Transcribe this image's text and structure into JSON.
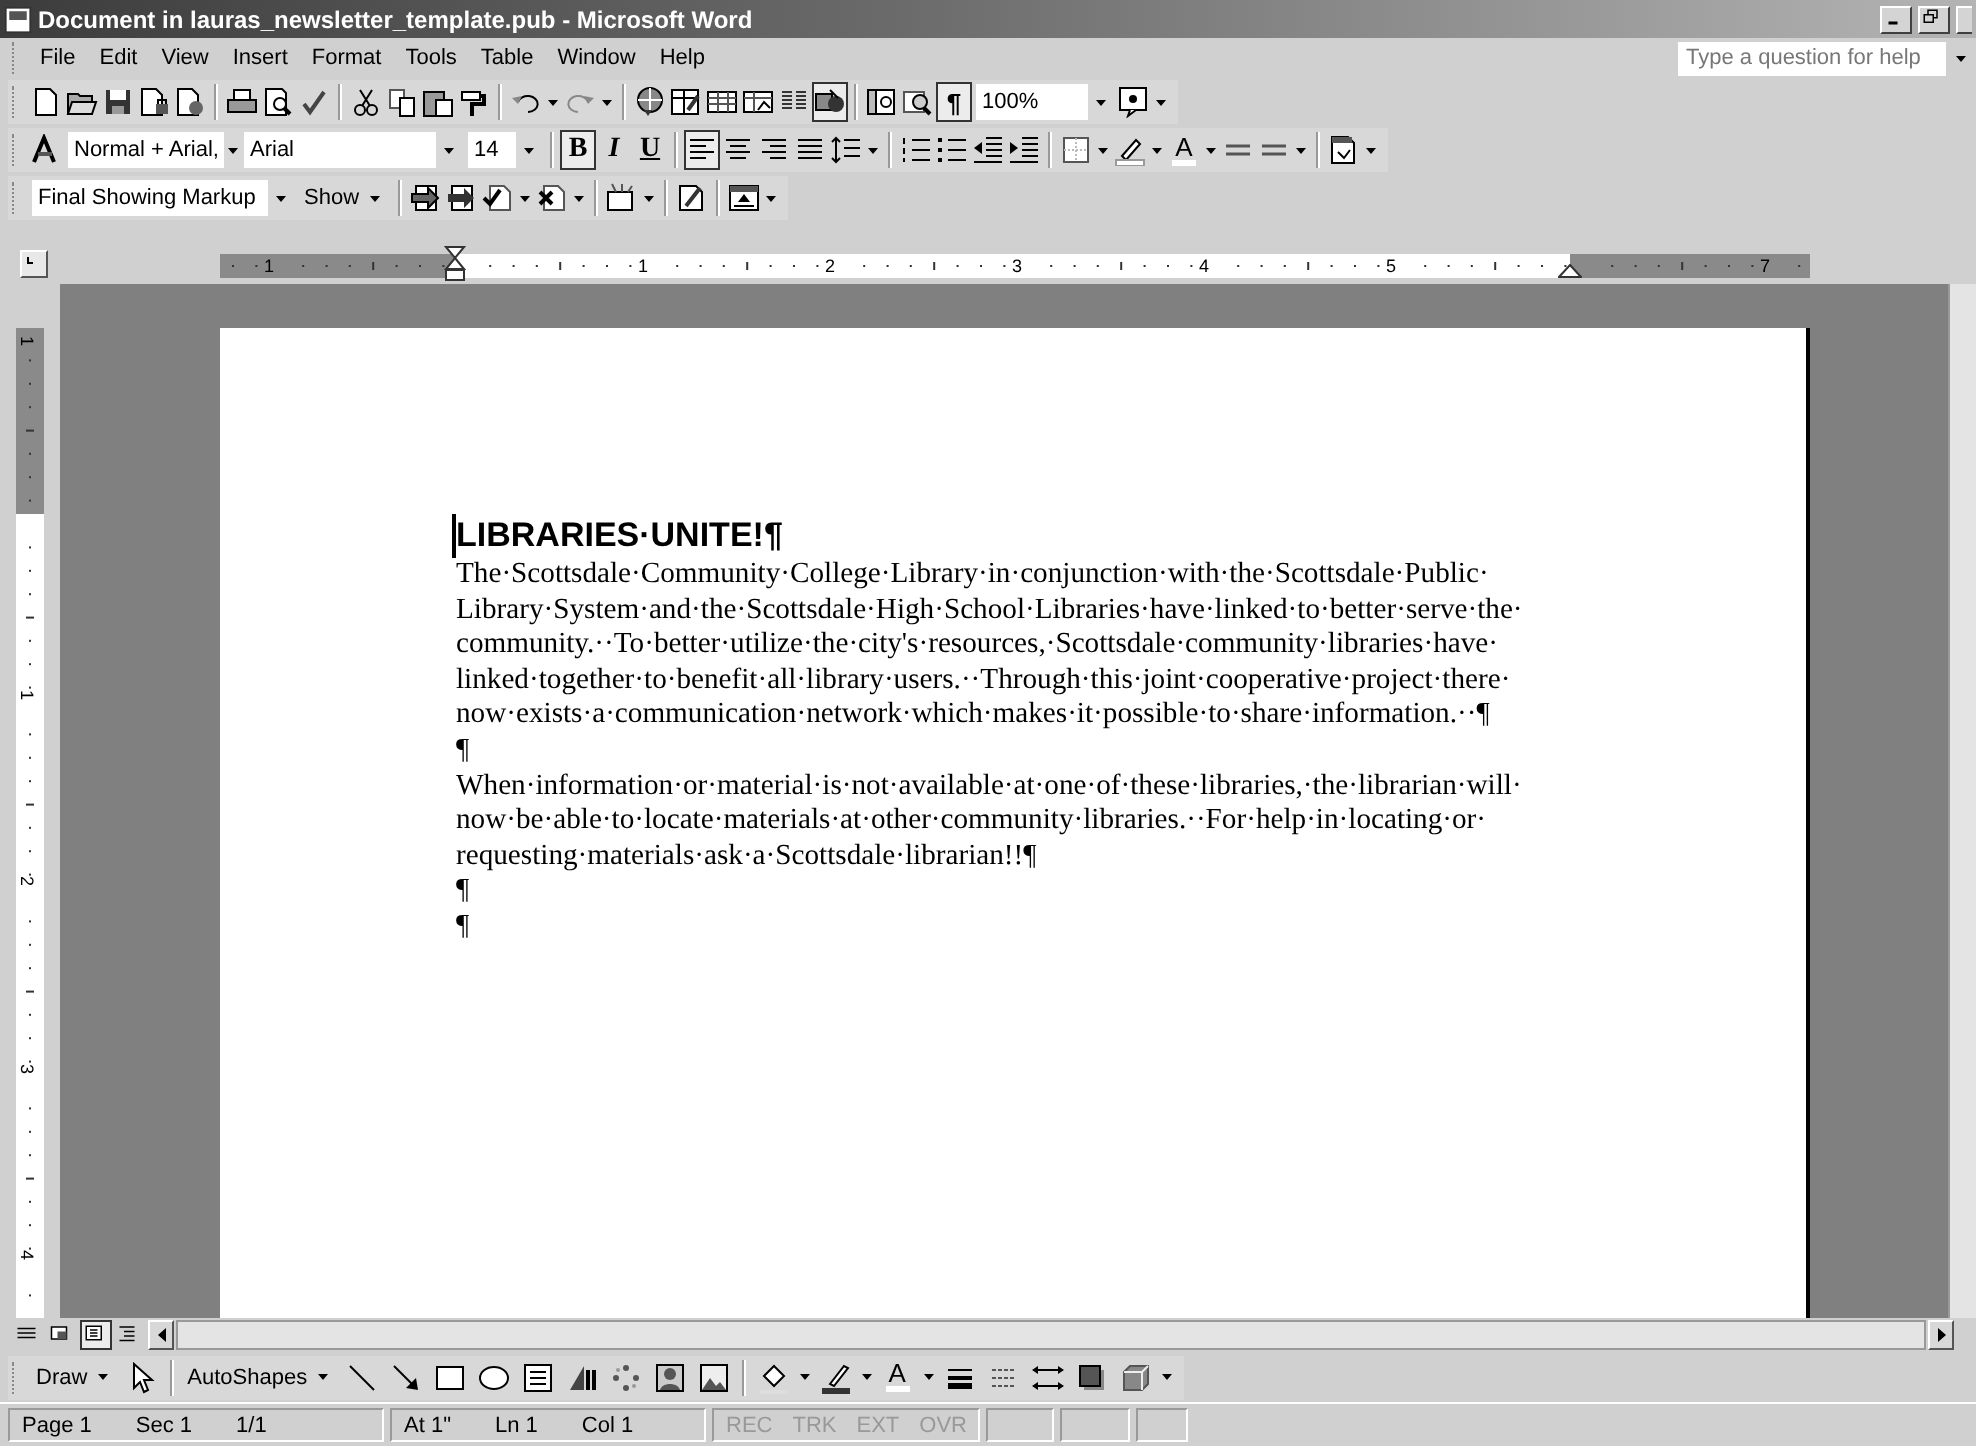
{
  "window": {
    "title": "Document in lauras_newsletter_template.pub - Microsoft Word"
  },
  "menu": [
    "File",
    "Edit",
    "View",
    "Insert",
    "Format",
    "Tools",
    "Table",
    "Window",
    "Help"
  ],
  "help_box": {
    "placeholder": "Type a question for help"
  },
  "standard_toolbar": {
    "drawing_on": true,
    "marks": {
      "label": "¶",
      "on": true
    },
    "zoom": "100%"
  },
  "formatting_toolbar": {
    "style": "Normal + Arial,",
    "font": "Arial",
    "size": "14",
    "bold": {
      "label": "B",
      "on": true
    },
    "italic": {
      "label": "I",
      "on": false
    },
    "underline": {
      "label": "U",
      "on": false
    },
    "alignment": [
      {
        "selected": true
      },
      {
        "selected": false
      },
      {
        "selected": false
      },
      {
        "selected": false
      }
    ],
    "font_color": "A"
  },
  "reviewing_toolbar": {
    "display": "Final Showing Markup",
    "show": "Show"
  },
  "ruler": {
    "labels": [
      "1",
      "1",
      "2",
      "3",
      "4",
      "5",
      "7"
    ]
  },
  "vertical_ruler": {
    "labels": [
      "1",
      "1",
      "2",
      "3",
      "4"
    ]
  },
  "document": {
    "title": "LIBRARIES·UNITE!¶",
    "paragraphs": [
      {
        "lines": [
          "The·Scottsdale·Community·College·Library·in·conjunction·with·the·Scottsdale·Public·",
          "Library·System·and·the·Scottsdale·High·School·Libraries·have·linked·to·better·serve·the·",
          "community.··To·better·utilize·the·city's·resources,·Scottsdale·community·libraries·have·",
          "linked·together·to·benefit·all·library·users.··Through·this·joint·cooperative·project·there·",
          "now·exists·a·communication·network·which·makes·it·possible·to·share·information.··¶"
        ]
      },
      {
        "lines": [
          "¶"
        ]
      },
      {
        "lines": [
          "When·information·or·material·is·not·available·at·one·of·these·libraries,·the·librarian·will·",
          "now·be·able·to·locate·materials·at·other·community·libraries.··For·help·in·locating·or·",
          "requesting·materials·ask·a·Scottsdale·librarian!!¶"
        ]
      },
      {
        "lines": [
          "¶"
        ]
      },
      {
        "lines": [
          "¶"
        ]
      }
    ]
  },
  "view_buttons": [
    {
      "selected": false
    },
    {
      "selected": false
    },
    {
      "selected": true
    },
    {
      "selected": false
    }
  ],
  "drawing_toolbar": {
    "draw": "Draw",
    "autoshapes": "AutoShapes",
    "font_color": "A"
  },
  "status_bar": {
    "fields": [
      "Page 1",
      "Sec 1",
      "1/1",
      "At 1\"",
      "Ln 1",
      "Col 1"
    ],
    "modes": [
      {
        "label": "REC",
        "on": false
      },
      {
        "label": "TRK",
        "on": false
      },
      {
        "label": "EXT",
        "on": false
      },
      {
        "label": "OVR",
        "on": false
      }
    ]
  }
}
